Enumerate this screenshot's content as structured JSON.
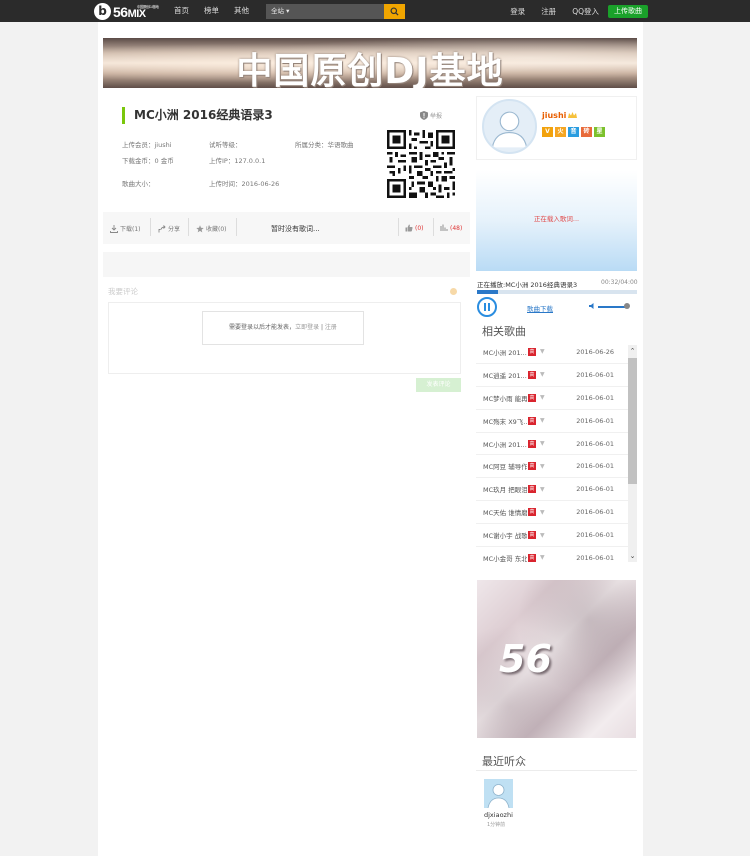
{
  "topbar": {
    "logo_mark": "b",
    "logo_num": "56",
    "logo_mix": "MIX",
    "logo_small": "中国原创DJ基地",
    "nav": [
      "首页",
      "榜单",
      "其他"
    ],
    "search_scope": "全站 ▾",
    "login": "登录",
    "register": "注册",
    "qq_login": "QQ登入",
    "upload": "上传歌曲"
  },
  "banner": {
    "text": "中国原创DJ基地"
  },
  "song": {
    "title": "MC小洲 2016经典语录3",
    "report": "举报",
    "uploader": "上传会员：jiushi",
    "listen_level": "试听等级：",
    "category": "所属分类：华语歌曲",
    "coins": "下载金币：0 金币",
    "upload_ip": "上传IP：127.0.0.1",
    "size": "歌曲大小：",
    "upload_time": "上传时间：2016-06-26"
  },
  "actions": {
    "download": "下载(1)",
    "share": "分享",
    "favorite": "收藏(0)",
    "no_lyrics": "暂时没有歌词...",
    "likes": "(0)",
    "plays": "(48)"
  },
  "comment": {
    "title": "我要评论",
    "login_tip": "需要登录以后才能发表，",
    "login_link": "立即登录",
    "sep": " | ",
    "register_link": "注册",
    "submit": "发表评论"
  },
  "user": {
    "name": "jiushi",
    "badges": [
      {
        "text": "V",
        "color": "#f2a20c"
      },
      {
        "text": "火",
        "color": "#f5a623"
      },
      {
        "text": "音",
        "color": "#2a9de0"
      },
      {
        "text": "砖",
        "color": "#e86a3a"
      },
      {
        "text": "星",
        "color": "#7cc12d"
      }
    ]
  },
  "ad": {
    "text": "正在载入歌词..."
  },
  "player": {
    "now_playing": "正在播放:MC小洲 2016经典语录3",
    "time": "00:32/04:00",
    "progress": 0.13,
    "download_link": "歌曲下载",
    "volume": 0.8
  },
  "related": {
    "title": "相关歌曲",
    "items": [
      {
        "name": "MC小洲 201...",
        "date": "2016-06-26"
      },
      {
        "name": "MC逍遥 201...",
        "date": "2016-06-01"
      },
      {
        "name": "MC梦小雨 能再...",
        "date": "2016-06-01"
      },
      {
        "name": "MC殇末 X9飞...",
        "date": "2016-06-01"
      },
      {
        "name": "MC小洲 201...",
        "date": "2016-06-01"
      },
      {
        "name": "MC阿豆 辅导作...",
        "date": "2016-06-01"
      },
      {
        "name": "MC玖月 把眼泪...",
        "date": "2016-06-01"
      },
      {
        "name": "MC天佑 谁情磨...",
        "date": "2016-06-01"
      },
      {
        "name": "MC谢小宇 战歌...",
        "date": "2016-06-01"
      },
      {
        "name": "MC小金哥 东北...",
        "date": "2016-06-01"
      }
    ],
    "tag": "高",
    "arrow": "▼"
  },
  "promo": {
    "text": "56"
  },
  "listeners": {
    "title": "最近听众",
    "items": [
      {
        "name": "djxiaozhi",
        "time": "1分钟前"
      }
    ]
  },
  "colors": {
    "accent_green": "#1aa12a",
    "title_bar": "#7ac70c",
    "link_blue": "#2a78c8",
    "tag_red": "#d9242e"
  }
}
